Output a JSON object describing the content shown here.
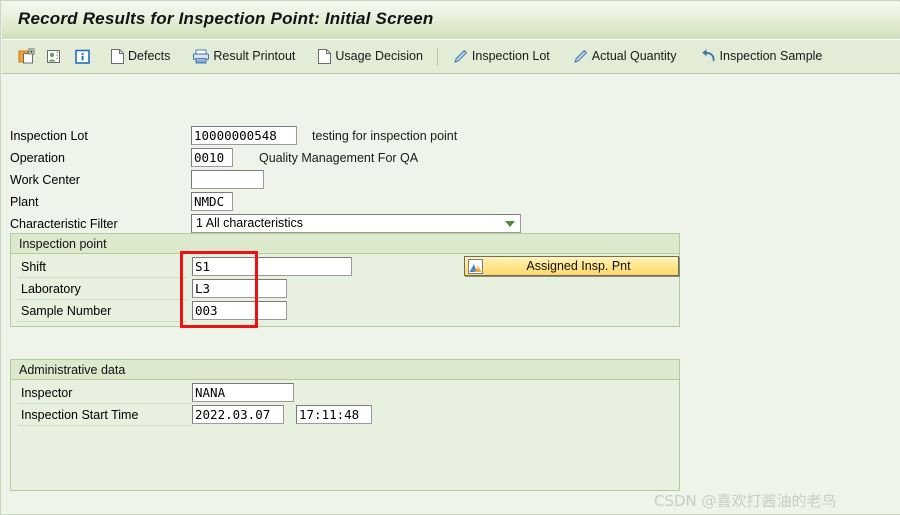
{
  "window": {
    "title": "Record Results for Inspection Point: Initial Screen"
  },
  "toolbar": {
    "items": [
      {
        "icon": "new-document-icon",
        "label": ""
      },
      {
        "icon": "inspector-person-icon",
        "label": ""
      },
      {
        "icon": "info-icon",
        "label": ""
      },
      {
        "icon": "document-icon",
        "label": "Defects"
      },
      {
        "icon": "printer-icon",
        "label": "Result Printout"
      },
      {
        "icon": "document-icon",
        "label": "Usage Decision"
      },
      {
        "icon": "pencil-icon",
        "label": "Inspection Lot"
      },
      {
        "icon": "pencil-icon",
        "label": "Actual Quantity"
      },
      {
        "icon": "undo-arrow-icon",
        "label": "Inspection Sample"
      }
    ]
  },
  "header_form": {
    "inspection_lot": {
      "label": "Inspection Lot",
      "value": "10000000548",
      "description": "testing for inspection point"
    },
    "operation": {
      "label": "Operation",
      "value": "0010",
      "description": "Quality Management For QA"
    },
    "work_center": {
      "label": "Work Center",
      "value": ""
    },
    "plant": {
      "label": "Plant",
      "value": "NMDC"
    },
    "characteristic_filter": {
      "label": "Characteristic Filter",
      "value": "1 All characteristics",
      "options": [
        "1 All characteristics"
      ]
    }
  },
  "inspection_point": {
    "title": "Inspection point",
    "shift": {
      "label": "Shift",
      "value": "S1"
    },
    "laboratory": {
      "label": "Laboratory",
      "value": "L3"
    },
    "sample_number": {
      "label": "Sample Number",
      "value": "003"
    },
    "assigned_button": {
      "label": "Assigned Insp. Pnt",
      "icon": "mountain-icon"
    }
  },
  "administrative_data": {
    "title": "Administrative data",
    "inspector": {
      "label": "Inspector",
      "value": "NANA"
    },
    "inspection_start_time": {
      "label": "Inspection Start Time",
      "date": "2022.03.07",
      "time": "17:11:48"
    }
  },
  "watermark": {
    "text": "CSDN @喜欢打酱油的老鸟"
  },
  "colors": {
    "title_bar_end": "#cfe0b8",
    "toolbar_bg": "#e3ecd6",
    "page_bg": "#eef4ea",
    "group_bg": "#e8f1df",
    "group_head_bg": "#dce9cd",
    "group_border": "#b4cc99",
    "annotation_red": "#ee1111",
    "button_yellow": "#ffe893",
    "dropdown_arrow_green": "#4c8b36"
  }
}
